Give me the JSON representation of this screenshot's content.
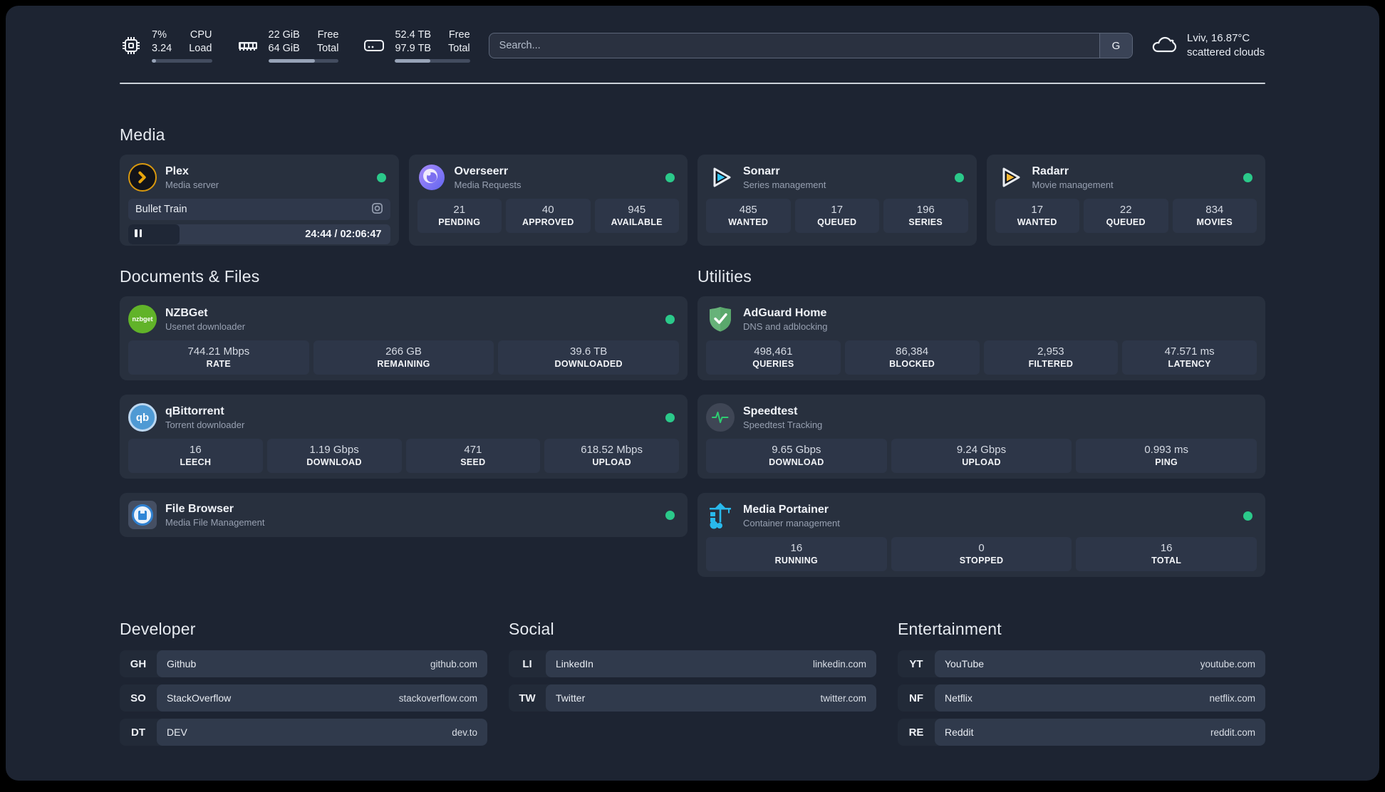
{
  "header": {
    "stats": [
      {
        "icon": "cpu-icon",
        "value_top": "7%",
        "value_bottom": "3.24",
        "label_top": "CPU",
        "label_bottom": "Load",
        "progress_pct": 7
      },
      {
        "icon": "memory-icon",
        "value_top": "22 GiB",
        "value_bottom": "64 GiB",
        "label_top": "Free",
        "label_bottom": "Total",
        "progress_pct": 66
      },
      {
        "icon": "disk-icon",
        "value_top": "52.4 TB",
        "value_bottom": "97.9 TB",
        "label_top": "Free",
        "label_bottom": "Total",
        "progress_pct": 47
      }
    ],
    "search": {
      "placeholder": "Search...",
      "engine": "G"
    },
    "weather": {
      "icon": "cloud-icon",
      "title": "Lviv, 16.87°C",
      "subtitle": "scattered clouds"
    }
  },
  "sections": {
    "media": {
      "title": "Media",
      "plex": {
        "icon": "plex-icon",
        "name": "Plex",
        "desc": "Media server",
        "status": "online",
        "now_playing": "Bullet Train",
        "time": "24:44 / 02:06:47",
        "progress_pct": 19.5
      },
      "overseerr": {
        "icon": "overseerr-icon",
        "name": "Overseerr",
        "desc": "Media Requests",
        "status": "online",
        "stats": [
          {
            "value": "21",
            "label": "PENDING"
          },
          {
            "value": "40",
            "label": "APPROVED"
          },
          {
            "value": "945",
            "label": "AVAILABLE"
          }
        ]
      },
      "sonarr": {
        "icon": "sonarr-icon",
        "name": "Sonarr",
        "desc": "Series management",
        "status": "online",
        "stats": [
          {
            "value": "485",
            "label": "WANTED"
          },
          {
            "value": "17",
            "label": "QUEUED"
          },
          {
            "value": "196",
            "label": "SERIES"
          }
        ]
      },
      "radarr": {
        "icon": "radarr-icon",
        "name": "Radarr",
        "desc": "Movie management",
        "status": "online",
        "stats": [
          {
            "value": "17",
            "label": "WANTED"
          },
          {
            "value": "22",
            "label": "QUEUED"
          },
          {
            "value": "834",
            "label": "MOVIES"
          }
        ]
      }
    },
    "documents": {
      "title": "Documents & Files",
      "nzbget": {
        "icon": "nzbget-icon",
        "badge_text": "nzbget",
        "name": "NZBGet",
        "desc": "Usenet downloader",
        "status": "online",
        "stats": [
          {
            "value": "744.21 Mbps",
            "label": "RATE"
          },
          {
            "value": "266 GB",
            "label": "REMAINING"
          },
          {
            "value": "39.6 TB",
            "label": "DOWNLOADED"
          }
        ]
      },
      "qbittorrent": {
        "icon": "qbittorrent-icon",
        "badge_text": "qb",
        "name": "qBittorrent",
        "desc": "Torrent downloader",
        "status": "online",
        "stats": [
          {
            "value": "16",
            "label": "LEECH"
          },
          {
            "value": "1.19 Gbps",
            "label": "DOWNLOAD"
          },
          {
            "value": "471",
            "label": "SEED"
          },
          {
            "value": "618.52 Mbps",
            "label": "UPLOAD"
          }
        ]
      },
      "filebrowser": {
        "icon": "filebrowser-icon",
        "name": "File Browser",
        "desc": "Media File Management",
        "status": "online"
      }
    },
    "utilities": {
      "title": "Utilities",
      "adguard": {
        "icon": "adguard-shield-icon",
        "name": "AdGuard Home",
        "desc": "DNS and adblocking",
        "stats": [
          {
            "value": "498,461",
            "label": "QUERIES"
          },
          {
            "value": "86,384",
            "label": "BLOCKED"
          },
          {
            "value": "2,953",
            "label": "FILTERED"
          },
          {
            "value": "47.571 ms",
            "label": "LATENCY"
          }
        ]
      },
      "speedtest": {
        "icon": "speedtest-pulse-icon",
        "name": "Speedtest",
        "desc": "Speedtest Tracking",
        "stats": [
          {
            "value": "9.65 Gbps",
            "label": "DOWNLOAD"
          },
          {
            "value": "9.24 Gbps",
            "label": "UPLOAD"
          },
          {
            "value": "0.993 ms",
            "label": "PING"
          }
        ]
      },
      "portainer": {
        "icon": "portainer-crane-icon",
        "name": "Media Portainer",
        "desc": "Container management",
        "status": "online",
        "stats": [
          {
            "value": "16",
            "label": "RUNNING"
          },
          {
            "value": "0",
            "label": "STOPPED"
          },
          {
            "value": "16",
            "label": "TOTAL"
          }
        ]
      }
    },
    "developer": {
      "title": "Developer",
      "links": [
        {
          "abbr": "GH",
          "name": "Github",
          "url": "github.com"
        },
        {
          "abbr": "SO",
          "name": "StackOverflow",
          "url": "stackoverflow.com"
        },
        {
          "abbr": "DT",
          "name": "DEV",
          "url": "dev.to"
        }
      ]
    },
    "social": {
      "title": "Social",
      "links": [
        {
          "abbr": "LI",
          "name": "LinkedIn",
          "url": "linkedin.com"
        },
        {
          "abbr": "TW",
          "name": "Twitter",
          "url": "twitter.com"
        }
      ]
    },
    "entertainment": {
      "title": "Entertainment",
      "links": [
        {
          "abbr": "YT",
          "name": "YouTube",
          "url": "youtube.com"
        },
        {
          "abbr": "NF",
          "name": "Netflix",
          "url": "netflix.com"
        },
        {
          "abbr": "RE",
          "name": "Reddit",
          "url": "reddit.com"
        }
      ]
    }
  },
  "colors": {
    "status_online": "#2bc98a",
    "page_background": "#1d2432",
    "card_background": "#28303e",
    "plex_gold": "#d8980e",
    "sonarr_cyan": "#36c6f4",
    "radarr_yellow": "#f7b733",
    "nzbget_green": "#61b329",
    "qbittorrent_blue": "#4f9ad4",
    "adguard_green": "#67b279",
    "speedtest_green": "#2ecc71",
    "portainer_blue": "#29b9ec"
  }
}
